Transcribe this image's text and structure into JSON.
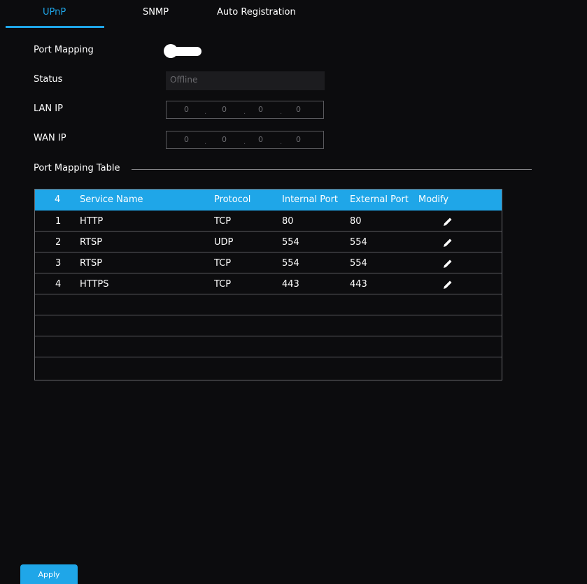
{
  "tabs": [
    {
      "label": "UPnP",
      "active": true
    },
    {
      "label": "SNMP",
      "active": false
    },
    {
      "label": "Auto Registration",
      "active": false
    }
  ],
  "form": {
    "port_mapping_label": "Port Mapping",
    "port_mapping_enabled": true,
    "status_label": "Status",
    "status_value": "Offline",
    "lan_ip_label": "LAN IP",
    "lan_ip": [
      "0",
      "0",
      "0",
      "0"
    ],
    "wan_ip_label": "WAN IP",
    "wan_ip": [
      "0",
      "0",
      "0",
      "0"
    ]
  },
  "table": {
    "title": "Port Mapping Table",
    "header": {
      "count": "4",
      "service_name": "Service Name",
      "protocol": "Protocol",
      "internal_port": "Internal Port",
      "external_port": "External Port",
      "modify": "Modify"
    },
    "rows": [
      {
        "index": "1",
        "service": "HTTP",
        "protocol": "TCP",
        "internal": "80",
        "external": "80"
      },
      {
        "index": "2",
        "service": "RTSP",
        "protocol": "UDP",
        "internal": "554",
        "external": "554"
      },
      {
        "index": "3",
        "service": "RTSP",
        "protocol": "TCP",
        "internal": "554",
        "external": "554"
      },
      {
        "index": "4",
        "service": "HTTPS",
        "protocol": "TCP",
        "internal": "443",
        "external": "443"
      }
    ],
    "modify_icon": "pencil-icon"
  },
  "apply_label": "Apply",
  "colors": {
    "accent": "#1fa6e8",
    "background": "#0c0c0e",
    "text": "#ffffff"
  }
}
